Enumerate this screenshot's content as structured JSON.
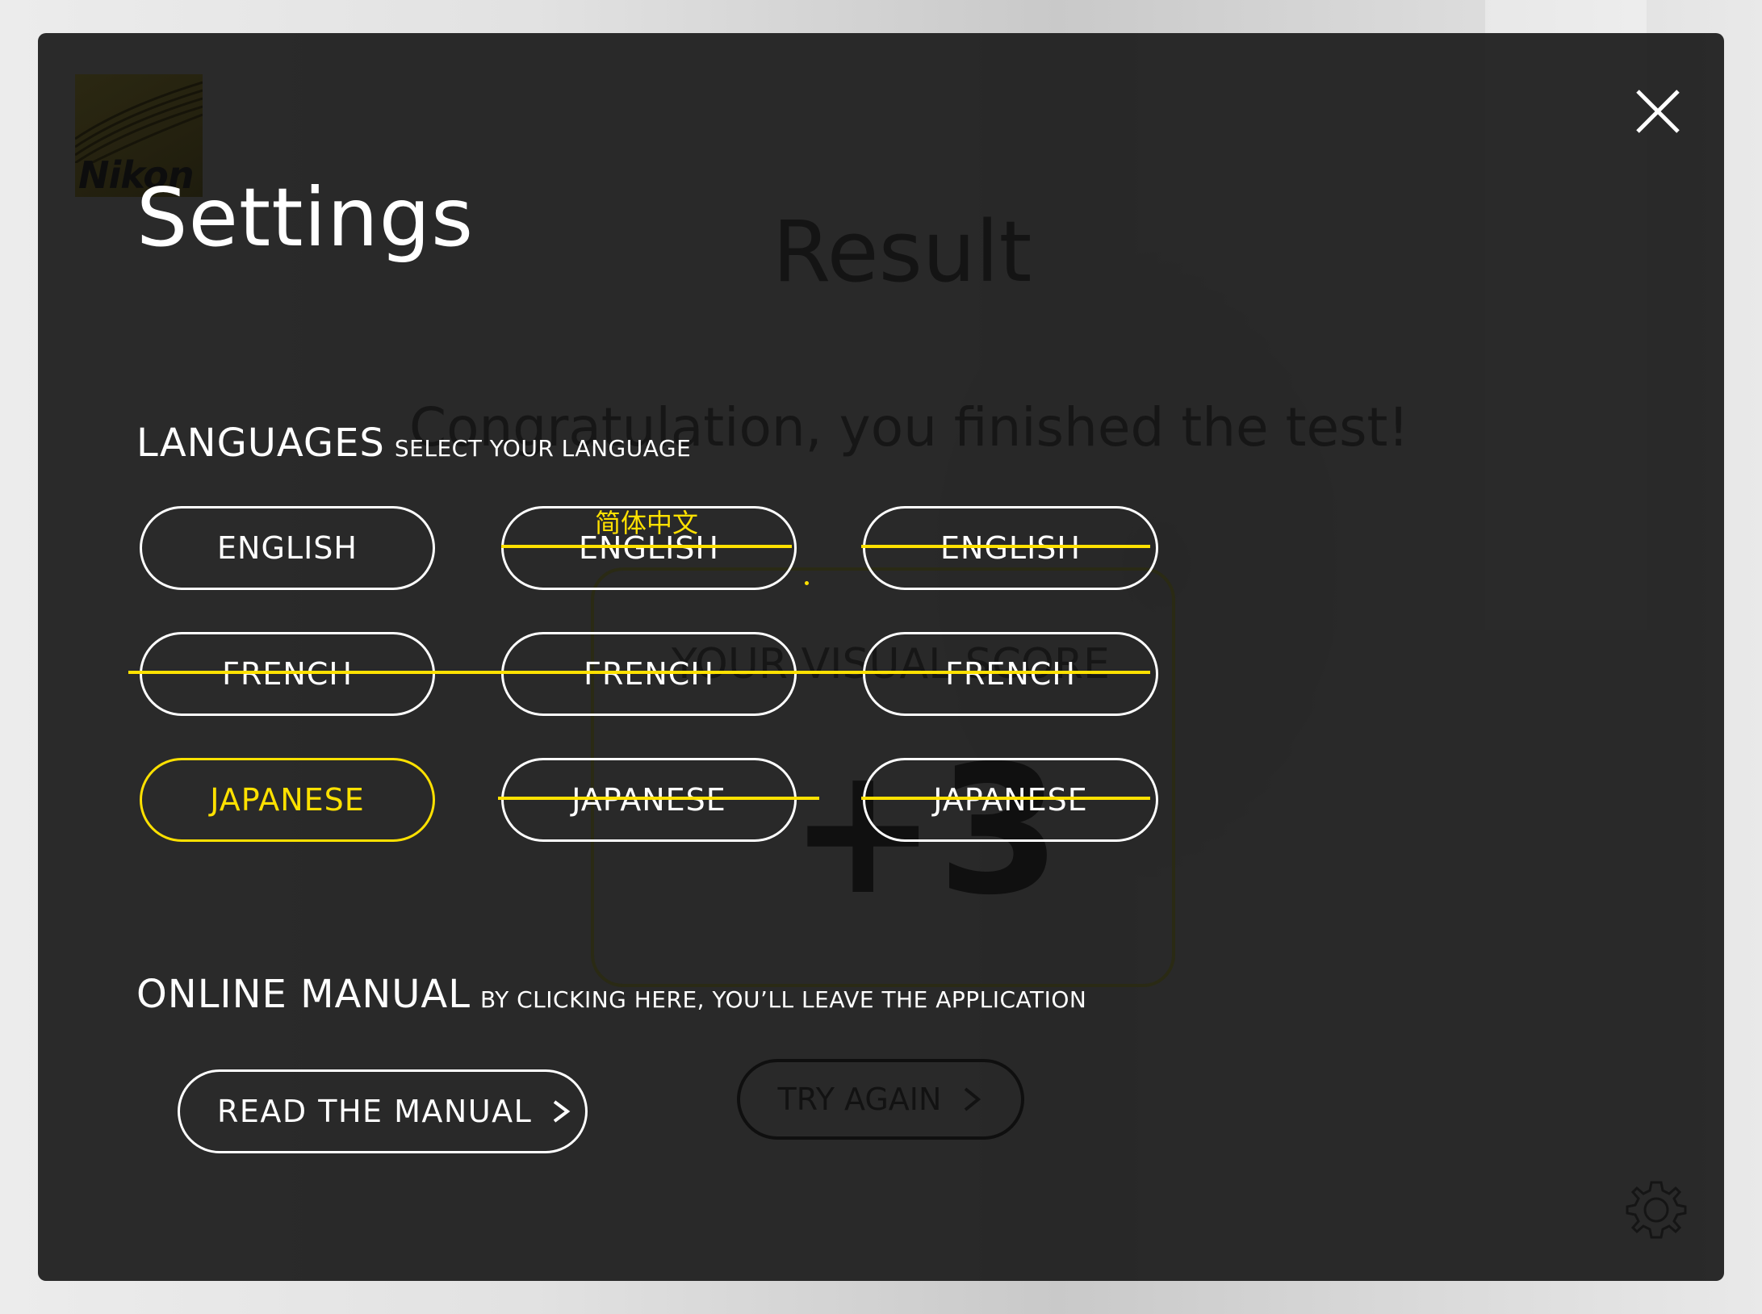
{
  "background": {
    "title": "Result",
    "message": "Congratulation, you finished the test!",
    "score_label": "YOUR VISUAL SCORE",
    "score_value": "+3",
    "try_again_label": "TRY AGAIN"
  },
  "brand": {
    "logo_text": "Nikon",
    "logo_color": "#2b2812"
  },
  "settings": {
    "title": "Settings",
    "close_icon": "close-icon",
    "languages": {
      "heading": "LANGUAGES",
      "subheading": "SELECT YOUR LANGUAGE",
      "options": [
        {
          "label": "ENGLISH",
          "selected": false,
          "struck": false
        },
        {
          "label": "ENGLISH",
          "overlay_label": "简体中文",
          "selected": false,
          "struck": true
        },
        {
          "label": "ENGLISH",
          "selected": false,
          "struck": true
        },
        {
          "label": "FRENCH",
          "selected": false,
          "struck": true
        },
        {
          "label": "FRENCH",
          "selected": false,
          "struck": true
        },
        {
          "label": "FRENCH",
          "selected": false,
          "struck": true
        },
        {
          "label": "JAPANESE",
          "selected": true,
          "struck": false
        },
        {
          "label": "JAPANESE",
          "selected": false,
          "struck": true
        },
        {
          "label": "JAPANESE",
          "selected": false,
          "struck": true
        }
      ]
    },
    "manual": {
      "heading": "ONLINE MANUAL",
      "subheading": "BY CLICKING HERE, YOU’LL LEAVE THE APPLICATION",
      "button_label": "READ THE MANUAL",
      "button_icon": "chevron-right-icon"
    }
  },
  "colors": {
    "modal_bg": "#222222",
    "accent": "#ffe100",
    "text": "#ffffff"
  }
}
